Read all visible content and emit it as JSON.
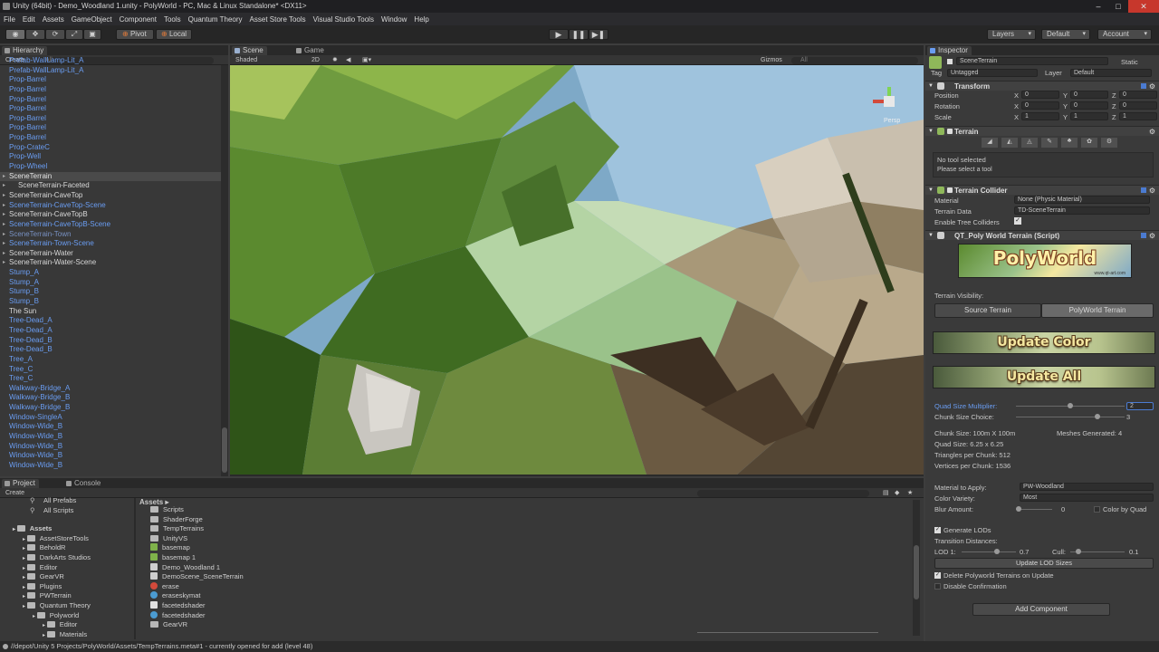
{
  "window": {
    "title": "Unity (64bit) - Demo_Woodland 1.unity - PolyWorld - PC, Mac & Linux Standalone* <DX11>"
  },
  "menu": [
    "File",
    "Edit",
    "Assets",
    "GameObject",
    "Component",
    "Tools",
    "Quantum Theory",
    "Asset Store Tools",
    "Visual Studio Tools",
    "Window",
    "Help"
  ],
  "toolbar": {
    "pivot": "Pivot",
    "local": "Local",
    "layers": "Layers",
    "layout": "Default",
    "account": "Account"
  },
  "hierarchy": {
    "tab": "Hierarchy",
    "create": "Create",
    "search_placeholder": "All",
    "items": [
      {
        "label": "Prefab-WallLamp-Lit_A",
        "style": "blue"
      },
      {
        "label": "Prefab-WallLamp-Lit_A",
        "style": "blue"
      },
      {
        "label": "Prop-Barrel",
        "style": "blue"
      },
      {
        "label": "Prop-Barrel",
        "style": "blue"
      },
      {
        "label": "Prop-Barrel",
        "style": "blue"
      },
      {
        "label": "Prop-Barrel",
        "style": "blue"
      },
      {
        "label": "Prop-Barrel",
        "style": "blue"
      },
      {
        "label": "Prop-Barrel",
        "style": "blue"
      },
      {
        "label": "Prop-Barrel",
        "style": "blue"
      },
      {
        "label": "Prop-CrateC",
        "style": "blue"
      },
      {
        "label": "Prop-Well",
        "style": "blue"
      },
      {
        "label": "Prop-Wheel",
        "style": "blue"
      },
      {
        "label": "SceneTerrain",
        "style": "selected"
      },
      {
        "label": "SceneTerrain-Faceted",
        "style": "white",
        "indent": true
      },
      {
        "label": "SceneTerrain-CaveTop",
        "style": "white"
      },
      {
        "label": "SceneTerrain-CaveTop-Scene",
        "style": "blue"
      },
      {
        "label": "SceneTerrain-CaveTopB",
        "style": "white"
      },
      {
        "label": "SceneTerrain-CaveTopB-Scene",
        "style": "blue"
      },
      {
        "label": "SceneTerrain-Town",
        "style": "dim"
      },
      {
        "label": "SceneTerrain-Town-Scene",
        "style": "blue"
      },
      {
        "label": "SceneTerrain-Water",
        "style": "white"
      },
      {
        "label": "SceneTerrain-Water-Scene",
        "style": "white"
      },
      {
        "label": "Stump_A",
        "style": "blue"
      },
      {
        "label": "Stump_A",
        "style": "blue"
      },
      {
        "label": "Stump_B",
        "style": "blue"
      },
      {
        "label": "Stump_B",
        "style": "blue"
      },
      {
        "label": "The Sun",
        "style": "white"
      },
      {
        "label": "Tree-Dead_A",
        "style": "blue"
      },
      {
        "label": "Tree-Dead_A",
        "style": "blue"
      },
      {
        "label": "Tree-Dead_B",
        "style": "blue"
      },
      {
        "label": "Tree-Dead_B",
        "style": "blue"
      },
      {
        "label": "Tree_A",
        "style": "blue"
      },
      {
        "label": "Tree_C",
        "style": "blue"
      },
      {
        "label": "Tree_C",
        "style": "blue"
      },
      {
        "label": "Walkway-Bridge_A",
        "style": "blue"
      },
      {
        "label": "Walkway-Bridge_B",
        "style": "blue"
      },
      {
        "label": "Walkway-Bridge_B",
        "style": "blue"
      },
      {
        "label": "Window-SingleA",
        "style": "blue"
      },
      {
        "label": "Window-Wide_B",
        "style": "blue"
      },
      {
        "label": "Window-Wide_B",
        "style": "blue"
      },
      {
        "label": "Window-Wide_B",
        "style": "blue"
      },
      {
        "label": "Window-Wide_B",
        "style": "blue"
      },
      {
        "label": "Window-Wide_B",
        "style": "blue"
      }
    ]
  },
  "scene": {
    "tab_scene": "Scene",
    "tab_game": "Game",
    "shading": "Shaded",
    "mode_2d": "2D",
    "gizmos": "Gizmos",
    "search_placeholder": "All",
    "persp_label": "Persp"
  },
  "inspector": {
    "tab": "Inspector",
    "object_name": "SceneTerrain",
    "static_label": "Static",
    "tag_label": "Tag",
    "tag_value": "Untagged",
    "layer_label": "Layer",
    "layer_value": "Default",
    "transform": {
      "title": "Transform",
      "rows": [
        {
          "label": "Position",
          "x": "0",
          "y": "0",
          "z": "0"
        },
        {
          "label": "Rotation",
          "x": "0",
          "y": "0",
          "z": "0"
        },
        {
          "label": "Scale",
          "x": "1",
          "y": "1",
          "z": "1"
        }
      ]
    },
    "terrain": {
      "title": "Terrain",
      "no_tool": "No tool selected",
      "hint": "Please select a tool"
    },
    "collider": {
      "title": "Terrain Collider",
      "material_label": "Material",
      "material_value": "None (Physic Material)",
      "data_label": "Terrain Data",
      "data_value": "TD-SceneTerrain",
      "trees_label": "Enable Tree Colliders"
    },
    "script": {
      "title": "QT_Poly World Terrain (Script)",
      "logo_text": "PolyWorld",
      "logo_url": "www.qt-art.com",
      "visibility_label": "Terrain Visibility:",
      "source_btn": "Source Terrain",
      "poly_btn": "PolyWorld Terrain",
      "update_color": "Update Color",
      "update_all": "Update All",
      "quad_label": "Quad Size Multiplier:",
      "quad_value": "2",
      "quad_fraction": 0.5,
      "chunk_label": "Chunk Size Choice:",
      "chunk_value": "3",
      "chunk_fraction": 0.75,
      "chunk_size": "Chunk Size: 100m X 100m",
      "meshes": "Meshes Generated: 4",
      "quad_size": "Quad Size: 6.25 x 6.25",
      "triangles": "Triangles per Chunk: 512",
      "vertices": "Vertices per Chunk: 1536",
      "material_label": "Material to Apply:",
      "material_value": "PW-Woodland",
      "variety_label": "Color Variety:",
      "variety_value": "Most",
      "blur_label": "Blur Amount:",
      "blur_value": "0",
      "color_by_quad": "Color by Quad",
      "gen_lods": "Generate LODs",
      "transition": "Transition Distances:",
      "lod1_label": "LOD 1:",
      "lod1_value": "0.7",
      "cull_label": "Cull:",
      "cull_value": "0.1",
      "update_lod": "Update LOD Sizes",
      "delete_label": "Delete Polyworld Terrains on Update",
      "disable_label": "Disable Confirmation"
    },
    "add_component": "Add Component"
  },
  "project": {
    "tab_project": "Project",
    "tab_console": "Console",
    "create": "Create",
    "favorites": [
      "All Prefabs",
      "All Scripts"
    ],
    "tree": [
      {
        "label": "Assets",
        "level": 0
      },
      {
        "label": "AssetStoreTools",
        "level": 1
      },
      {
        "label": "BeholdR",
        "level": 1
      },
      {
        "label": "DarkArts Studios",
        "level": 1
      },
      {
        "label": "Editor",
        "level": 1
      },
      {
        "label": "GearVR",
        "level": 1
      },
      {
        "label": "Plugins",
        "level": 1
      },
      {
        "label": "PWTerrain",
        "level": 1
      },
      {
        "label": "Quantum Theory",
        "level": 1
      },
      {
        "label": "Polyworld",
        "level": 2
      },
      {
        "label": "Editor",
        "level": 3
      },
      {
        "label": "Materials",
        "level": 3
      }
    ],
    "assets_header": "Assets",
    "assets": [
      {
        "label": "Scripts",
        "icon": "folder"
      },
      {
        "label": "ShaderForge",
        "icon": "folder"
      },
      {
        "label": "TempTerrains",
        "icon": "folder"
      },
      {
        "label": "UnityVS",
        "icon": "folder"
      },
      {
        "label": "basemap",
        "icon": "texture"
      },
      {
        "label": "basemap 1",
        "icon": "texture"
      },
      {
        "label": "Demo_Woodland 1",
        "icon": "unity"
      },
      {
        "label": "DemoScene_SceneTerrain",
        "icon": "unity"
      },
      {
        "label": "erase",
        "icon": "script"
      },
      {
        "label": "eraseskymat",
        "icon": "material"
      },
      {
        "label": "facetedshader",
        "icon": "shader"
      },
      {
        "label": "facetedshader",
        "icon": "material"
      },
      {
        "label": "GearVR",
        "icon": "folder"
      }
    ]
  },
  "status": "//depot/Unity 5 Projects/PolyWorld/Assets/TempTerrains.meta#1 - currently opened for add (level 48)"
}
